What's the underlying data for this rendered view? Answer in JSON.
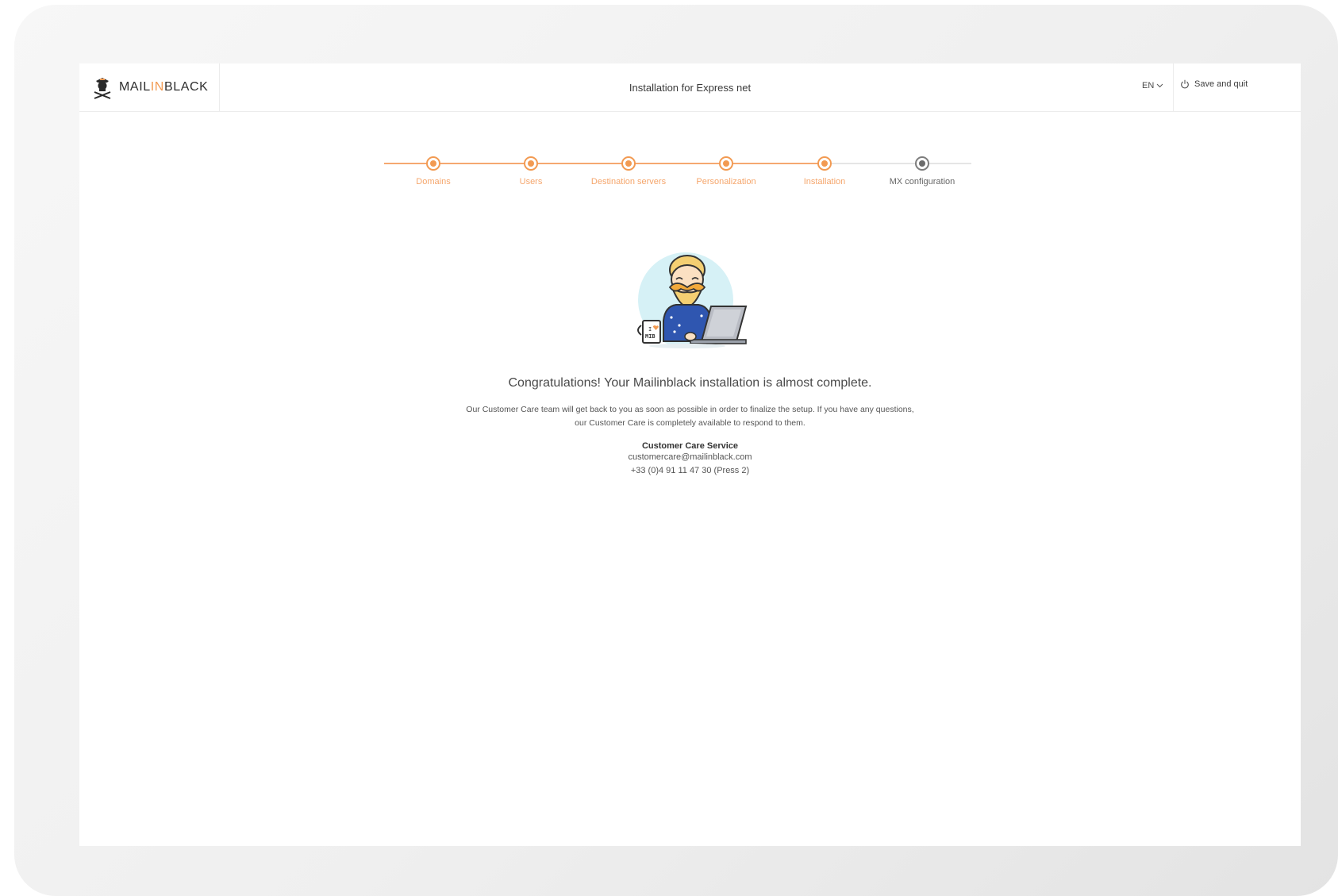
{
  "header": {
    "logo": {
      "text_main": "MAIL",
      "text_accent": "IN",
      "text_end": "BLACK"
    },
    "title": "Installation for Express net",
    "language": "EN",
    "save_quit_label": "Save and quit"
  },
  "stepper": {
    "steps": [
      {
        "label": "Domains",
        "state": "done"
      },
      {
        "label": "Users",
        "state": "done"
      },
      {
        "label": "Destination servers",
        "state": "done"
      },
      {
        "label": "Personalization",
        "state": "done"
      },
      {
        "label": "Installation",
        "state": "done"
      },
      {
        "label": "MX configuration",
        "state": "current"
      }
    ]
  },
  "illustration": {
    "mug_text_top": "I",
    "mug_text_bottom": "MIB"
  },
  "content": {
    "title": "Congratulations! Your Mailinblack installation is almost complete.",
    "description_line1": "Our Customer Care team will get back to you as soon as possible in order to finalize the setup. If you have any questions,",
    "description_line2": "our Customer Care is completely available to respond to them.",
    "customer_care": {
      "title": "Customer Care Service",
      "email": "customercare@mailinblack.com",
      "phone": "+33 (0)4 91 11 47 30 (Press 2)"
    }
  },
  "colors": {
    "accent": "#f29a52",
    "accent_light": "#f5a870",
    "inactive": "#7d7d7d"
  }
}
